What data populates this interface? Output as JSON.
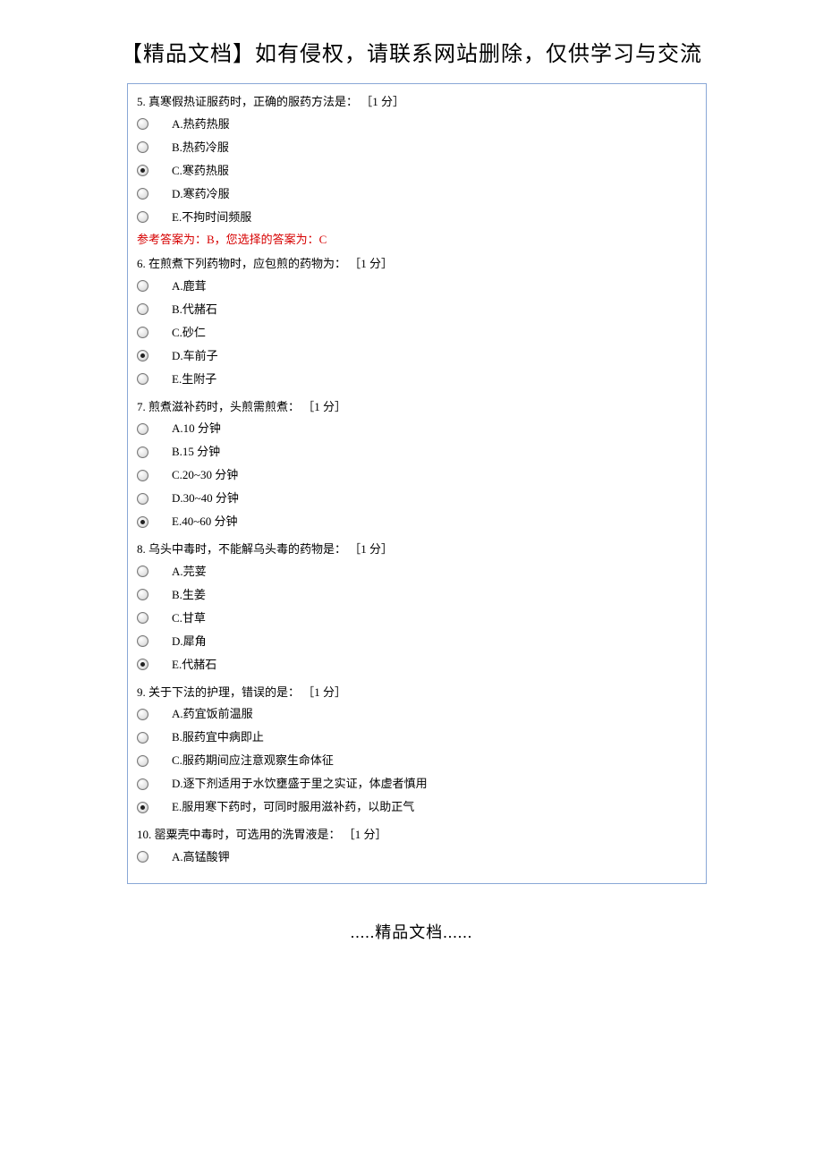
{
  "header": "【精品文档】如有侵权，请联系网站删除，仅供学习与交流",
  "footer": ".....精品文档......",
  "questions": [
    {
      "number": "5.",
      "text": "真寒假热证服药时，正确的服药方法是：",
      "points": "［1 分］",
      "selectedIndex": 2,
      "answerLine": "参考答案为：B，您选择的答案为：C",
      "options": [
        "A.热药热服",
        "B.热药冷服",
        "C.寒药热服",
        "D.寒药冷服",
        "E.不拘时间频服"
      ]
    },
    {
      "number": "6.",
      "text": "在煎煮下列药物时，应包煎的药物为：",
      "points": "［1 分］",
      "selectedIndex": 3,
      "answerLine": "",
      "options": [
        "A.鹿茸",
        "B.代赭石",
        "C.砂仁",
        "D.车前子",
        "E.生附子"
      ]
    },
    {
      "number": "7.",
      "text": "煎煮滋补药时，头煎需煎煮：",
      "points": "［1 分］",
      "selectedIndex": 4,
      "answerLine": "",
      "options": [
        "A.10 分钟",
        "B.15 分钟",
        "C.20~30 分钟",
        "D.30~40 分钟",
        "E.40~60 分钟"
      ]
    },
    {
      "number": "8.",
      "text": "乌头中毒时，不能解乌头毒的药物是：",
      "points": "［1 分］",
      "selectedIndex": 4,
      "answerLine": "",
      "options": [
        "A.芫荽",
        "B.生姜",
        "C.甘草",
        "D.犀角",
        "E.代赭石"
      ]
    },
    {
      "number": "9.",
      "text": "关于下法的护理，错误的是：",
      "points": "［1 分］",
      "selectedIndex": 4,
      "answerLine": "",
      "options": [
        "A.药宜饭前温服",
        "B.服药宜中病即止",
        "C.服药期间应注意观察生命体征",
        "D.逐下剂适用于水饮壅盛于里之实证，体虚者慎用",
        "E.服用寒下药时，可同时服用滋补药，以助正气"
      ]
    },
    {
      "number": "10.",
      "text": "罂粟壳中毒时，可选用的洗胃液是：",
      "points": "［1 分］",
      "selectedIndex": -1,
      "answerLine": "",
      "options": [
        "A.高锰酸钾"
      ]
    }
  ]
}
